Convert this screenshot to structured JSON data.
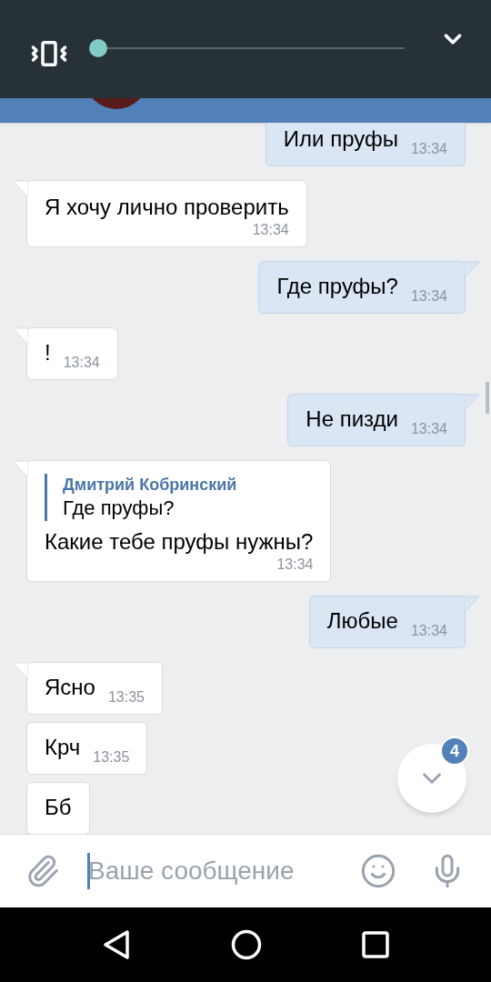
{
  "volume": {
    "level": 0
  },
  "messages": [
    {
      "kind": "out",
      "text": "Или пруфы",
      "time": "13:34",
      "time_below": false
    },
    {
      "kind": "in",
      "text": "Я хочу лично проверить",
      "time": "13:34",
      "time_below": true
    },
    {
      "kind": "out",
      "text": "Где пруфы?",
      "time": "13:34",
      "time_below": false
    },
    {
      "kind": "in",
      "text": "!",
      "time": "13:34",
      "time_below": false
    },
    {
      "kind": "out",
      "text": "Не пизди",
      "time": "13:34",
      "time_below": false
    },
    {
      "kind": "in",
      "text": "Какие тебе пруфы нужны?",
      "time": "13:34",
      "time_below": true,
      "reply": {
        "author": "Дмитрий Кобринский",
        "text": "Где пруфы?"
      }
    },
    {
      "kind": "out",
      "text": "Любые",
      "time": "13:34",
      "time_below": false
    },
    {
      "kind": "in",
      "text": "Ясно",
      "time": "13:35",
      "time_below": false
    },
    {
      "kind": "in",
      "text": "Крч",
      "time": "13:35",
      "time_below": false
    },
    {
      "kind": "in",
      "text": "Бб",
      "time_below": false
    }
  ],
  "scroll_button": {
    "badge": "4"
  },
  "composer": {
    "placeholder": "Ваше сообщение"
  }
}
